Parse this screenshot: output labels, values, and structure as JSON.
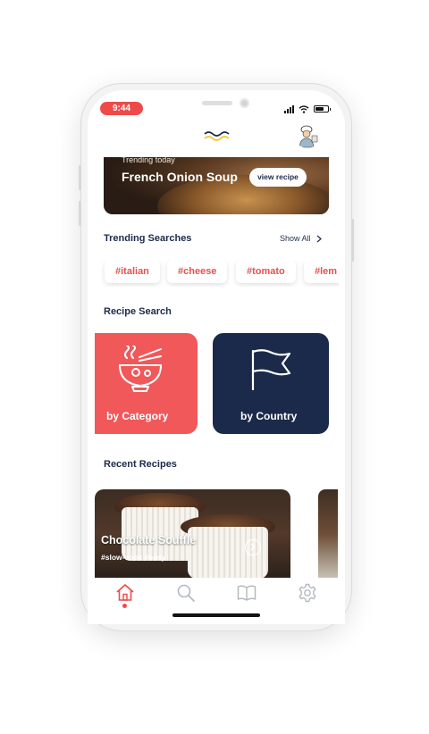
{
  "status_bar": {
    "time": "9:44"
  },
  "hero": {
    "tag": "Trending today",
    "title": "French Onion Soup",
    "button_label": "view recipe"
  },
  "trending": {
    "title": "Trending Searches",
    "show_all": "Show All",
    "chips": [
      "#italian",
      "#cheese",
      "#tomato",
      "#lem"
    ]
  },
  "recipe_search": {
    "title": "Recipe Search",
    "by_category": "by Category",
    "by_country": "by Country"
  },
  "recent": {
    "title": "Recent Recipes",
    "card": {
      "title": "Chocolate Souffle",
      "tags": "#slow-cook #easy"
    }
  },
  "tabs": [
    "home-icon",
    "search-icon",
    "book-icon",
    "settings-icon"
  ],
  "colors": {
    "accent": "#ee4a4a",
    "coral": "#f0585a",
    "navy": "#1b2a4a"
  }
}
